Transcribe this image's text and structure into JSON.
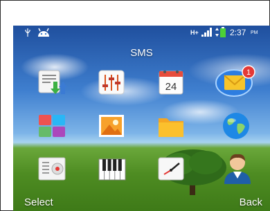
{
  "status_bar": {
    "network": "H+",
    "time": "2:37",
    "ampm": "PM"
  },
  "screen": {
    "title": "SMS"
  },
  "apps": [
    {
      "icon": "download-app-icon"
    },
    {
      "icon": "equalizer-app-icon"
    },
    {
      "icon": "calendar-app-icon",
      "day": "24"
    },
    {
      "icon": "messages-app-icon",
      "badge": "1"
    },
    {
      "icon": "tiles-app-icon"
    },
    {
      "icon": "gallery-app-icon"
    },
    {
      "icon": "folder-app-icon"
    },
    {
      "icon": "globe-app-icon"
    },
    {
      "icon": "radio-app-icon"
    },
    {
      "icon": "piano-app-icon"
    },
    {
      "icon": "clock-app-icon"
    },
    {
      "icon": "contacts-app-icon"
    }
  ],
  "softkeys": {
    "left": "Select",
    "right": "Back"
  }
}
